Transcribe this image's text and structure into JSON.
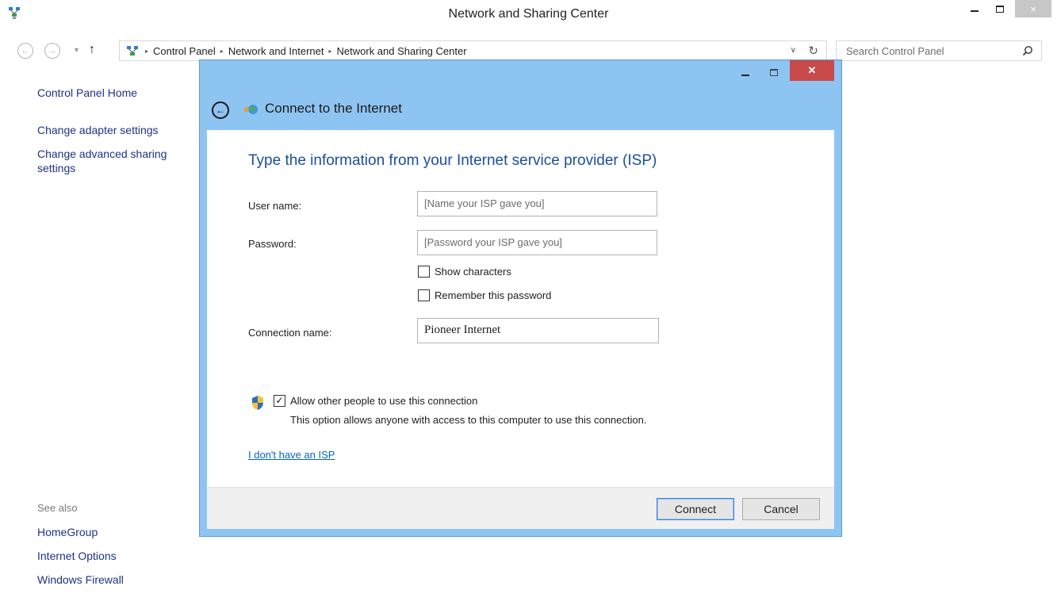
{
  "window": {
    "title": "Network and Sharing Center",
    "min_label": "",
    "close_label": "×"
  },
  "navigation": {
    "back_glyph": "←",
    "forward_glyph": "→",
    "dropdown_glyph": "▼",
    "up_glyph": "↑",
    "breadcrumbs": [
      "Control Panel",
      "Network and Internet",
      "Network and Sharing Center"
    ],
    "crumb_separator": "▸",
    "address_dropdown_glyph": "∨",
    "refresh_glyph": "↻",
    "search_placeholder": "Search Control Panel"
  },
  "sidebar": {
    "home": "Control Panel Home",
    "adapter": "Change adapter settings",
    "advanced_line1": "Change advanced sharing",
    "advanced_line2": "settings",
    "see_also": "See also",
    "homegroup": "HomeGroup",
    "internet_options": "Internet Options",
    "firewall": "Windows Firewall"
  },
  "dialog": {
    "title": "Connect to the Internet",
    "back_glyph": "←",
    "close_glyph": "✕",
    "heading": "Type the information from your Internet service provider (ISP)",
    "username_label": "User name:",
    "username_placeholder": "[Name your ISP gave you]",
    "password_label": "Password:",
    "password_placeholder": "[Password your ISP gave you]",
    "show_characters": "Show characters",
    "show_characters_checked": false,
    "remember_password": "Remember this password",
    "remember_password_checked": false,
    "connection_name_label": "Connection name:",
    "connection_name_value": "Pioneer Internet",
    "allow_others": "Allow other people to use this connection",
    "allow_others_checked": true,
    "check_glyph": "✓",
    "allow_others_desc": "This option allows anyone with access to this computer to use this connection.",
    "no_isp_link": "I don't have an ISP",
    "connect_button": "Connect",
    "cancel_button": "Cancel"
  },
  "colors": {
    "dialog_frame": "#8ec4f1",
    "heading_blue": "#1c4ea0",
    "link_blue": "#1e3287",
    "close_red": "#c94a4a"
  }
}
